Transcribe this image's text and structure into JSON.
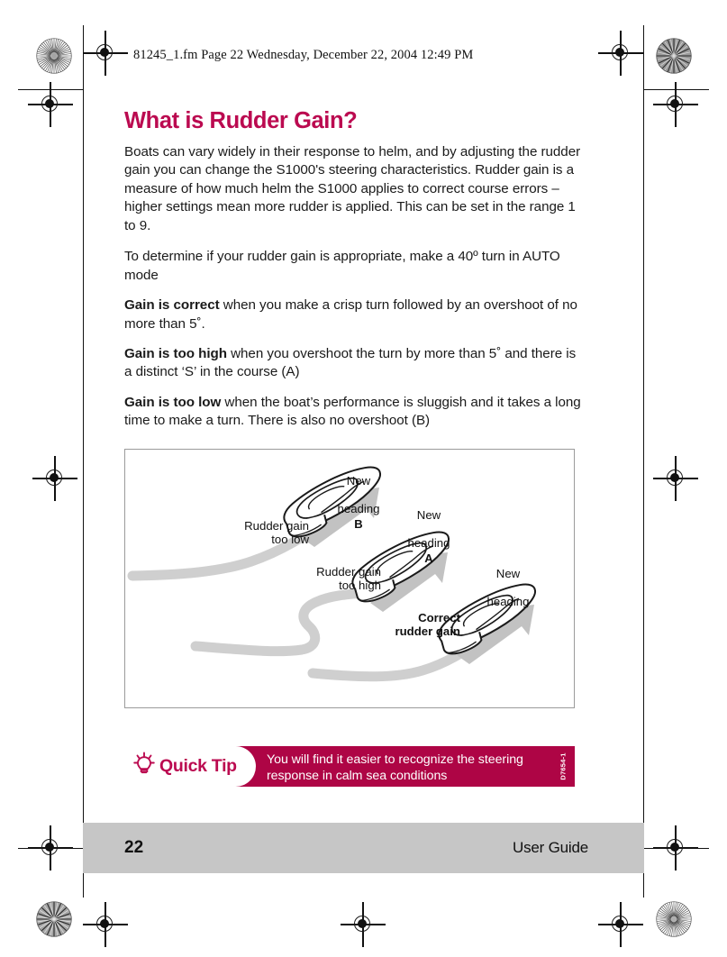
{
  "document_header": "81245_1.fm  Page 22  Wednesday, December 22, 2004  12:49 PM",
  "colors": {
    "heading": "#bb0a50",
    "tip_bar": "#ae0545",
    "footer_bar": "#c6c6c6",
    "track_gray": "#cfcfcf",
    "arrow_gray": "#c2c2c2"
  },
  "content": {
    "title": "What is Rudder Gain?",
    "paragraphs": [
      {
        "id": "intro",
        "text": "Boats can vary widely in their response to helm, and by adjusting the rudder gain you can change the S1000's steering characteristics. Rudder gain is a measure of how much helm the S1000 applies to correct course errors – higher settings mean more rudder is applied. This can be set in the range 1 to 9."
      },
      {
        "id": "determine",
        "text": "To determine if your rudder gain is appropriate, make a 40º turn in AUTO mode"
      },
      {
        "id": "gain-correct",
        "lead": "Gain is correct",
        "text": " when you make a crisp turn followed by an overshoot of no more than 5˚."
      },
      {
        "id": "gain-too-high",
        "lead": "Gain is too high",
        "text": " when you overshoot the turn by more than 5˚ and there is a distinct ‘S’ in the course (A)"
      },
      {
        "id": "gain-too-low",
        "lead": "Gain is too low",
        "text": " when the boat’s performance is sluggish and it takes a long time to make a turn. There is also no overshoot (B)"
      }
    ]
  },
  "diagram": {
    "labels": {
      "new_heading_b_line1": "New",
      "new_heading_b_line2": "heading",
      "new_heading_b_marker": "B",
      "new_heading_a_line1": "New",
      "new_heading_a_line2": "heading",
      "new_heading_a_marker": "A",
      "new_heading_c_line1": "New",
      "new_heading_c_line2": "heading",
      "rudder_gain_too_low": "Rudder gain\ntoo low",
      "rudder_gain_too_high": "Rudder gain\ntoo high",
      "correct_rudder_gain": "Correct\nrudder gain"
    }
  },
  "quick_tip": {
    "label": "Quick Tip",
    "icon": "lightbulb-icon",
    "text": "You will find it easier to recognize the steering response in calm sea conditions",
    "code": "D7654-1"
  },
  "footer": {
    "page_number": "22",
    "guide_label": "User Guide"
  }
}
